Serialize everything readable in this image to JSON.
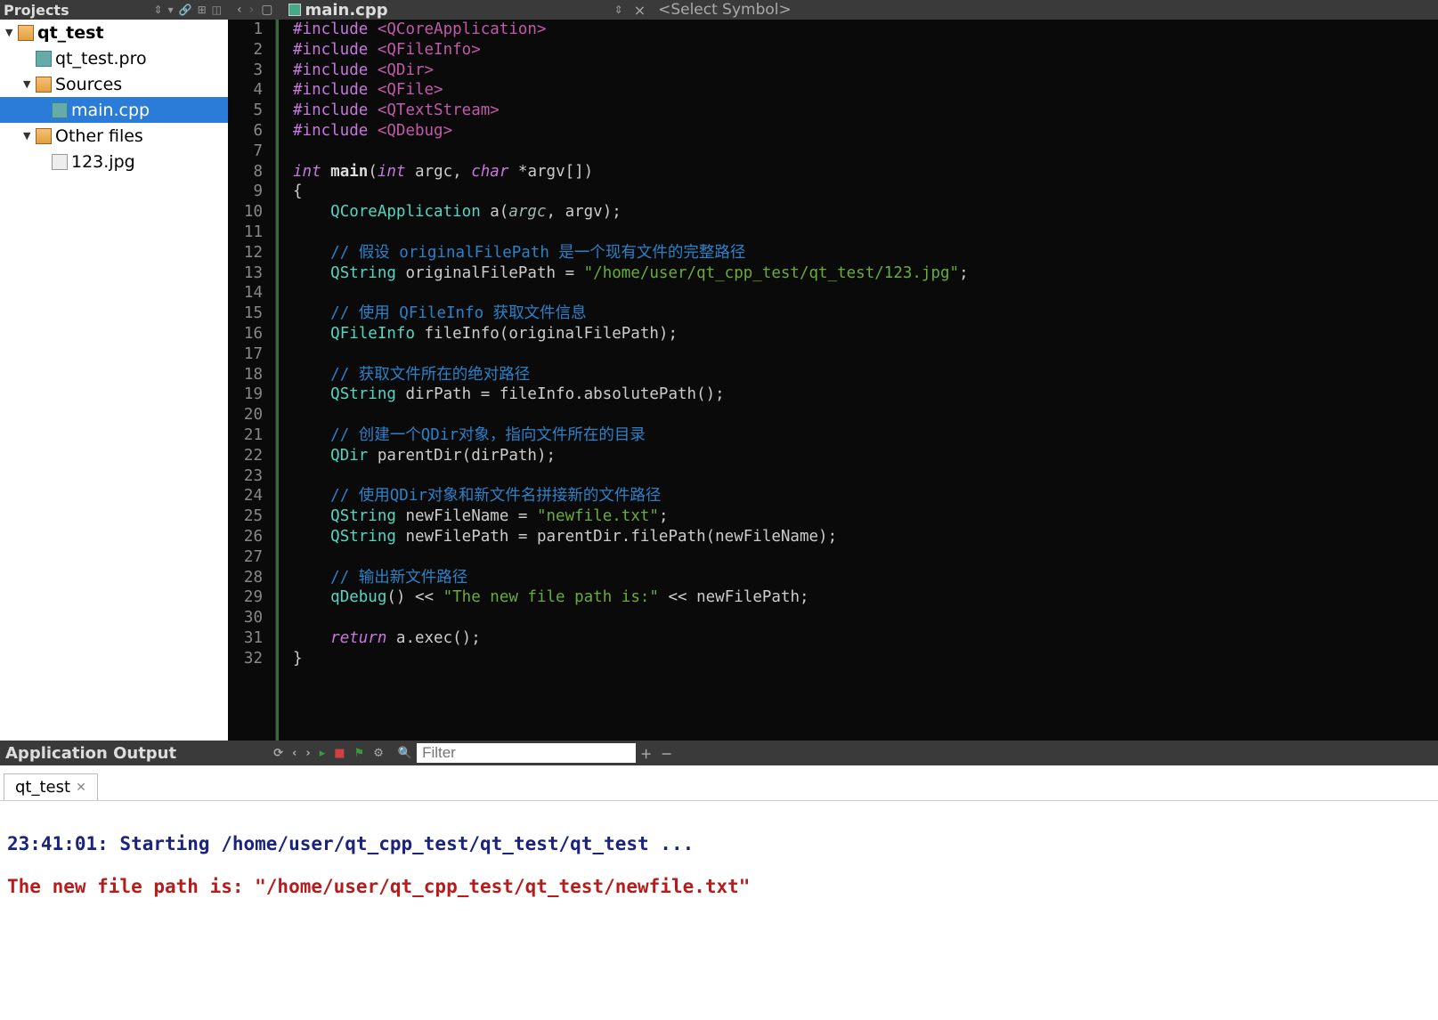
{
  "titlebar": {
    "projects_label": "Projects",
    "filename": "main.cpp",
    "symbol_placeholder": "<Select Symbol>"
  },
  "project_tree": {
    "root": "qt_test",
    "pro_file": "qt_test.pro",
    "sources_label": "Sources",
    "main_cpp": "main.cpp",
    "other_files_label": "Other files",
    "other_file_1": "123.jpg"
  },
  "code": {
    "lines": [
      {
        "n": 1,
        "t": "include",
        "inc": "#include",
        "hdr": "<QCoreApplication>"
      },
      {
        "n": 2,
        "t": "include",
        "inc": "#include",
        "hdr": "<QFileInfo>"
      },
      {
        "n": 3,
        "t": "include",
        "inc": "#include",
        "hdr": "<QDir>"
      },
      {
        "n": 4,
        "t": "include",
        "inc": "#include",
        "hdr": "<QFile>"
      },
      {
        "n": 5,
        "t": "include",
        "inc": "#include",
        "hdr": "<QTextStream>"
      },
      {
        "n": 6,
        "t": "include",
        "inc": "#include",
        "hdr": "<QDebug>"
      },
      {
        "n": 7,
        "t": "blank"
      },
      {
        "n": 8,
        "t": "main_sig"
      },
      {
        "n": 9,
        "t": "brace_open"
      },
      {
        "n": 10,
        "t": "qcoreapp"
      },
      {
        "n": 11,
        "t": "blank"
      },
      {
        "n": 12,
        "t": "comment",
        "txt": "// 假设 originalFilePath 是一个现有文件的完整路径"
      },
      {
        "n": 13,
        "t": "qstring_assign",
        "var": "originalFilePath",
        "val": "\"/home/user/qt_cpp_test/qt_test/123.jpg\""
      },
      {
        "n": 14,
        "t": "blank"
      },
      {
        "n": 15,
        "t": "comment",
        "txt": "// 使用 QFileInfo 获取文件信息"
      },
      {
        "n": 16,
        "t": "qfileinfo"
      },
      {
        "n": 17,
        "t": "blank"
      },
      {
        "n": 18,
        "t": "comment",
        "txt": "// 获取文件所在的绝对路径"
      },
      {
        "n": 19,
        "t": "qstring_call",
        "var": "dirPath",
        "call": "fileInfo.absolutePath()"
      },
      {
        "n": 20,
        "t": "blank"
      },
      {
        "n": 21,
        "t": "comment",
        "txt": "// 创建一个QDir对象，指向文件所在的目录"
      },
      {
        "n": 22,
        "t": "qdir"
      },
      {
        "n": 23,
        "t": "blank"
      },
      {
        "n": 24,
        "t": "comment",
        "txt": "// 使用QDir对象和新文件名拼接新的文件路径"
      },
      {
        "n": 25,
        "t": "qstring_assign",
        "var": "newFileName",
        "val": "\"newfile.txt\""
      },
      {
        "n": 26,
        "t": "qstring_call",
        "var": "newFilePath",
        "call": "parentDir.filePath(newFileName)"
      },
      {
        "n": 27,
        "t": "blank"
      },
      {
        "n": 28,
        "t": "comment",
        "txt": "// 输出新文件路径"
      },
      {
        "n": 29,
        "t": "qdebug",
        "str": "\"The new file path is:\"",
        "rhs": "newFilePath"
      },
      {
        "n": 30,
        "t": "blank"
      },
      {
        "n": 31,
        "t": "return"
      },
      {
        "n": 32,
        "t": "brace_close"
      }
    ]
  },
  "output": {
    "panel_title": "Application Output",
    "filter_placeholder": "Filter",
    "tab_label": "qt_test",
    "line1": "23:41:01: Starting /home/user/qt_cpp_test/qt_test/qt_test ...",
    "line2": "The new file path is: \"/home/user/qt_cpp_test/qt_test/newfile.txt\""
  }
}
